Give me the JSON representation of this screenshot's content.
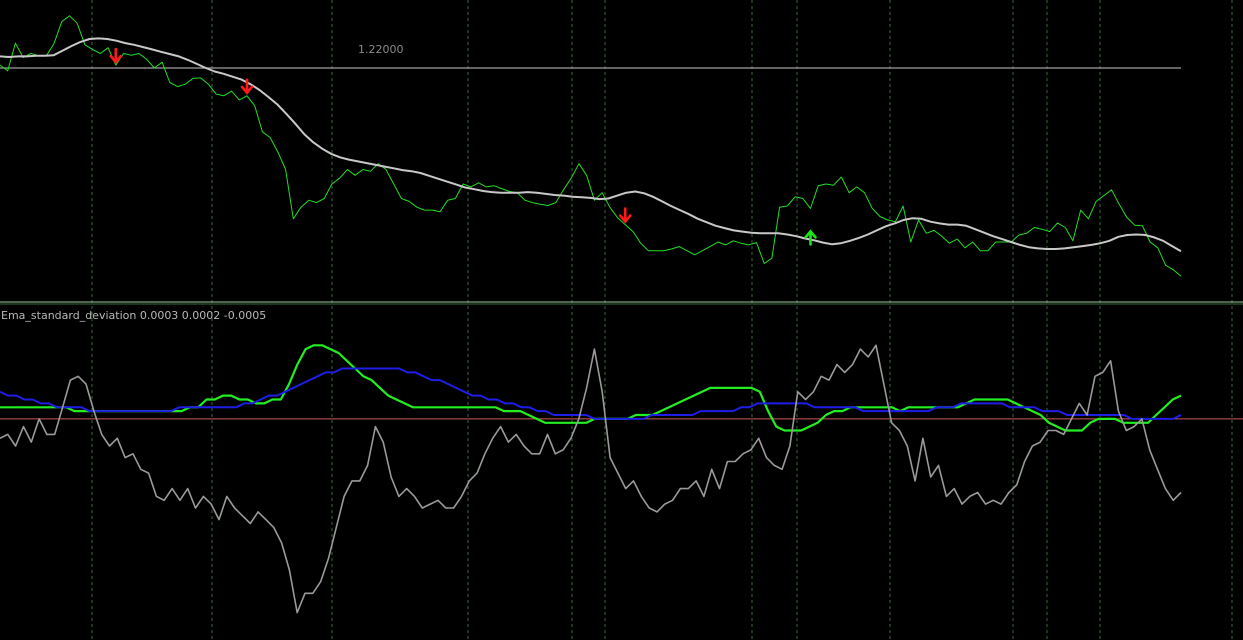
{
  "main_panel": {
    "price_line_label": "1.22000"
  },
  "indicator_panel": {
    "label": "Ema_standard_deviation 0.0003 0.0002 -0.0005"
  },
  "colors": {
    "background": "#000000",
    "price": "#22dd22",
    "price_ma": "#c8c8c8",
    "level_line": "#a0a0a0",
    "separator": "#9ec49e",
    "vgrid": "#3a6a3a",
    "arrow_down": "#ff1a1a",
    "arrow_up": "#19e619",
    "ind_green": "#22ee22",
    "ind_blue": "#1e1ee6",
    "ind_gray": "#9a9a9a",
    "zero_line": "#d05a5a"
  },
  "chart_data": [
    {
      "type": "line",
      "pane": "main",
      "x_count": 150,
      "series": [
        {
          "id": "price",
          "values": [
            1.2205,
            1.2195,
            1.2243,
            1.2218,
            1.2225,
            1.2221,
            1.2221,
            1.2242,
            1.228,
            1.229,
            1.2277,
            1.224,
            1.2232,
            1.2225,
            1.2235,
            1.2205,
            1.2225,
            1.2222,
            1.2225,
            1.2215,
            1.22,
            1.221,
            1.2175,
            1.2168,
            1.2172,
            1.2182,
            1.2183,
            1.2172,
            1.2155,
            1.2152,
            1.216,
            1.2145,
            1.2152,
            1.2135,
            1.209,
            1.208,
            1.2055,
            1.2025,
            1.194,
            1.196,
            1.1972,
            1.1968,
            1.1975,
            1.2,
            1.201,
            1.2025,
            1.2015,
            1.2025,
            1.2022,
            1.2035,
            1.2025,
            1.2,
            1.1975,
            1.197,
            1.196,
            1.1955,
            1.1955,
            1.1952,
            1.1972,
            1.1975,
            1.2,
            1.1995,
            1.2002,
            1.1995,
            1.1997,
            1.1992,
            1.1987,
            1.1985,
            1.1972,
            1.1968,
            1.1965,
            1.1963,
            1.1968,
            1.199,
            1.201,
            1.2035,
            1.2015,
            1.1972,
            1.1985,
            1.196,
            1.1942,
            1.193,
            1.1918,
            1.1898,
            1.1885,
            1.1885,
            1.1885,
            1.1888,
            1.1892,
            1.1885,
            1.1878,
            1.1885,
            1.1892,
            1.19,
            1.1895,
            1.1902,
            1.1898,
            1.1895,
            1.1899,
            1.1863,
            1.1872,
            1.196,
            1.1962,
            1.1978,
            1.1975,
            1.1958,
            1.1997,
            1.2,
            1.1998,
            1.2012,
            1.1985,
            1.1995,
            1.1985,
            1.1958,
            1.1944,
            1.1938,
            1.1935,
            1.1962,
            1.19,
            1.1938,
            1.1915,
            1.192,
            1.191,
            1.1898,
            1.1905,
            1.189,
            1.19,
            1.1885,
            1.1885,
            1.19,
            1.19,
            1.19,
            1.1912,
            1.1915,
            1.1925,
            1.1922,
            1.1918,
            1.1933,
            1.1925,
            1.1902,
            1.1955,
            1.194,
            1.197,
            1.198,
            1.199,
            1.1965,
            1.1942,
            1.1929,
            1.1928,
            1.19,
            1.189,
            1.186,
            1.1852,
            1.1841
          ]
        },
        {
          "id": "price_ma",
          "values": [
            1.222,
            1.2219,
            1.222,
            1.222,
            1.2221,
            1.2221,
            1.2222,
            1.223,
            1.2238,
            1.2245,
            1.225,
            1.2251,
            1.225,
            1.2247,
            1.2243,
            1.224,
            1.2236,
            1.2232,
            1.2228,
            1.2224,
            1.222,
            1.2214,
            1.2207,
            1.22,
            1.2194,
            1.219,
            1.2185,
            1.218,
            1.2172,
            1.2162,
            1.215,
            1.2137,
            1.2121,
            1.2104,
            1.2086,
            1.2072,
            1.2061,
            1.2052,
            1.2046,
            1.2042,
            1.2039,
            1.2036,
            1.2033,
            1.203,
            1.2027,
            1.2024,
            1.2022,
            1.2019,
            1.2014,
            1.2009,
            1.2004,
            1.1999,
            1.1994,
            1.1991,
            1.1988,
            1.1986,
            1.1985,
            1.1985,
            1.1985,
            1.1986,
            1.1985,
            1.1983,
            1.1981,
            1.198,
            1.1978,
            1.1977,
            1.1976,
            1.1974,
            1.1975,
            1.198,
            1.1985,
            1.1987,
            1.1984,
            1.1978,
            1.197,
            1.1962,
            1.1955,
            1.1948,
            1.194,
            1.1934,
            1.1928,
            1.1924,
            1.192,
            1.1918,
            1.1916,
            1.1915,
            1.1915,
            1.1915,
            1.1913,
            1.191,
            1.1906,
            1.1903,
            1.1899,
            1.1896,
            1.1898,
            1.1902,
            1.1907,
            1.1913,
            1.192,
            1.1927,
            1.1932,
            1.1938,
            1.1941,
            1.194,
            1.1935,
            1.1932,
            1.193,
            1.193,
            1.1928,
            1.1922,
            1.1916,
            1.191,
            1.1905,
            1.19,
            1.1895,
            1.1891,
            1.1889,
            1.1888,
            1.1888,
            1.1889,
            1.1891,
            1.1893,
            1.1895,
            1.1898,
            1.1902,
            1.1909,
            1.1912,
            1.1913,
            1.1912,
            1.1908,
            1.1902,
            1.1893,
            1.1884
          ]
        }
      ],
      "signals": [
        {
          "type": "down",
          "index": 15
        },
        {
          "type": "down",
          "index": 32
        },
        {
          "type": "down",
          "index": 81
        },
        {
          "type": "up",
          "index": 105
        }
      ],
      "level": 1.22,
      "ylim": [
        1.18,
        1.23
      ]
    },
    {
      "type": "line",
      "pane": "indicator",
      "x_count": 150,
      "series": [
        {
          "id": "ema_green",
          "values": [
            0.0003,
            0.0003,
            0.0003,
            0.0003,
            0.0003,
            0.0003,
            0.0003,
            0.0003,
            0.0003,
            0.0002,
            0.0002,
            0.0002,
            0.0002,
            0.0002,
            0.0002,
            0.0002,
            0.0002,
            0.0002,
            0.0002,
            0.0002,
            0.0002,
            0.0002,
            0.0002,
            0.0003,
            0.0003,
            0.0005,
            0.0005,
            0.0006,
            0.0006,
            0.0005,
            0.0005,
            0.0004,
            0.0004,
            0.0005,
            0.0005,
            0.0009,
            0.0014,
            0.0018,
            0.0019,
            0.0019,
            0.0018,
            0.0017,
            0.0015,
            0.0013,
            0.0011,
            0.001,
            0.0008,
            0.0006,
            0.0005,
            0.0004,
            0.0003,
            0.0003,
            0.0003,
            0.0003,
            0.0003,
            0.0003,
            0.0003,
            0.0003,
            0.0003,
            0.0003,
            0.0003,
            0.0002,
            0.0002,
            0.0002,
            0.0001,
            0.0,
            -0.0001,
            -0.0001,
            -0.0001,
            -0.0001,
            -0.0001,
            -0.0001,
            0.0,
            0.0,
            0.0,
            0.0,
            0.0,
            0.0001,
            0.0001,
            0.0001,
            0.0002,
            0.0003,
            0.0004,
            0.0005,
            0.0006,
            0.0007,
            0.0008,
            0.0008,
            0.0008,
            0.0008,
            0.0008,
            0.0008,
            0.0007,
            0.0002,
            -0.0002,
            -0.0003,
            -0.0003,
            -0.0003,
            -0.0002,
            -0.0001,
            0.0001,
            0.0002,
            0.0002,
            0.0003,
            0.0003,
            0.0003,
            0.0003,
            0.0003,
            0.0003,
            0.0002,
            0.0003,
            0.0003,
            0.0003,
            0.0003,
            0.0003,
            0.0003,
            0.0003,
            0.0004,
            0.0005,
            0.0005,
            0.0005,
            0.0005,
            0.0005,
            0.0004,
            0.0003,
            0.0002,
            0.0001,
            -0.0001,
            -0.0002,
            -0.0003,
            -0.0003,
            -0.0003,
            -0.0001,
            0.0,
            0.0,
            0.0,
            -0.0001,
            -0.0001,
            -0.0001,
            -0.0001,
            0.0001,
            0.0003,
            0.0005,
            0.0006
          ]
        },
        {
          "id": "ema_blue",
          "values": [
            0.0007,
            0.0006,
            0.0006,
            0.0005,
            0.0005,
            0.0004,
            0.0004,
            0.0003,
            0.0003,
            0.0003,
            0.0003,
            0.0002,
            0.0002,
            0.0002,
            0.0002,
            0.0002,
            0.0002,
            0.0002,
            0.0002,
            0.0002,
            0.0002,
            0.0002,
            0.0003,
            0.0003,
            0.0003,
            0.0003,
            0.0003,
            0.0003,
            0.0003,
            0.0003,
            0.0004,
            0.0004,
            0.0005,
            0.0006,
            0.0006,
            0.0007,
            0.0008,
            0.0009,
            0.001,
            0.0011,
            0.0012,
            0.0012,
            0.0013,
            0.0013,
            0.0013,
            0.0013,
            0.0013,
            0.0013,
            0.0013,
            0.0013,
            0.0012,
            0.0012,
            0.0011,
            0.001,
            0.001,
            0.0009,
            0.0008,
            0.0007,
            0.0006,
            0.0006,
            0.0005,
            0.0005,
            0.0004,
            0.0004,
            0.0003,
            0.0003,
            0.0002,
            0.0002,
            0.0001,
            0.0001,
            0.0001,
            0.0001,
            0.0001,
            0.0,
            0.0,
            0.0,
            0.0,
            0.0,
            0.0,
            0.0,
            0.0001,
            0.0001,
            0.0001,
            0.0001,
            0.0001,
            0.0001,
            0.0002,
            0.0002,
            0.0002,
            0.0002,
            0.0002,
            0.0003,
            0.0003,
            0.0004,
            0.0004,
            0.0004,
            0.0004,
            0.0004,
            0.0004,
            0.0004,
            0.0003,
            0.0003,
            0.0003,
            0.0003,
            0.0003,
            0.0003,
            0.0002,
            0.0002,
            0.0002,
            0.0002,
            0.0002,
            0.0002,
            0.0002,
            0.0002,
            0.0002,
            0.0003,
            0.0003,
            0.0003,
            0.0004,
            0.0004,
            0.0004,
            0.0004,
            0.0004,
            0.0004,
            0.0003,
            0.0003,
            0.0003,
            0.0003,
            0.0002,
            0.0002,
            0.0002,
            0.0001,
            0.0001,
            0.0001,
            0.0001,
            0.0001,
            0.0001,
            0.0001,
            0.0001,
            0.0,
            0.0,
            0.0,
            0.0,
            0.0,
            0.0,
            0.0001
          ]
        },
        {
          "id": "std_gray",
          "values": [
            -0.0005,
            -0.0004,
            -0.0007,
            -0.0002,
            -0.0006,
            0.0,
            -0.0004,
            -0.0004,
            0.0003,
            0.001,
            0.0011,
            0.0009,
            0.0002,
            -0.0004,
            -0.0007,
            -0.0005,
            -0.001,
            -0.0009,
            -0.0013,
            -0.0014,
            -0.002,
            -0.0021,
            -0.0018,
            -0.0021,
            -0.0018,
            -0.0023,
            -0.002,
            -0.0022,
            -0.0026,
            -0.002,
            -0.0023,
            -0.0025,
            -0.0027,
            -0.0024,
            -0.0026,
            -0.0028,
            -0.0032,
            -0.0039,
            -0.005,
            -0.0045,
            -0.0045,
            -0.0042,
            -0.0036,
            -0.0028,
            -0.002,
            -0.0016,
            -0.0016,
            -0.0012,
            -0.0002,
            -0.0006,
            -0.0015,
            -0.002,
            -0.0018,
            -0.002,
            -0.0023,
            -0.0022,
            -0.0021,
            -0.0023,
            -0.0023,
            -0.002,
            -0.0016,
            -0.0014,
            -0.0009,
            -0.0005,
            -0.0002,
            -0.0006,
            -0.0004,
            -0.0007,
            -0.0009,
            -0.0009,
            -0.0004,
            -0.0009,
            -0.0008,
            -0.0005,
            0.0,
            0.0008,
            0.0018,
            0.0007,
            -0.001,
            -0.0014,
            -0.0018,
            -0.0016,
            -0.002,
            -0.0023,
            -0.0024,
            -0.0022,
            -0.0021,
            -0.0018,
            -0.0018,
            -0.0016,
            -0.002,
            -0.0013,
            -0.0018,
            -0.0011,
            -0.0011,
            -0.0009,
            -0.0008,
            -0.0005,
            -0.001,
            -0.0012,
            -0.0013,
            -0.0007,
            0.0007,
            0.0005,
            0.0007,
            0.0011,
            0.001,
            0.0014,
            0.0012,
            0.0014,
            0.0018,
            0.0016,
            0.0019,
            0.0009,
            -0.0001,
            -0.0003,
            -0.0007,
            -0.0016,
            -0.0005,
            -0.0015,
            -0.0012,
            -0.002,
            -0.0018,
            -0.0022,
            -0.002,
            -0.0019,
            -0.0022,
            -0.0021,
            -0.0022,
            -0.0019,
            -0.0017,
            -0.0011,
            -0.0007,
            -0.0006,
            -0.0003,
            -0.0003,
            -0.0004,
            0.0,
            0.0004,
            0.0001,
            0.0011,
            0.0012,
            0.0015,
            0.0002,
            -0.0003,
            -0.0002,
            0.0,
            -0.0008,
            -0.0013,
            -0.0018,
            -0.0021,
            -0.0019
          ]
        }
      ],
      "zero_line": 0,
      "ylim": [
        -0.0055,
        0.0025
      ]
    }
  ]
}
